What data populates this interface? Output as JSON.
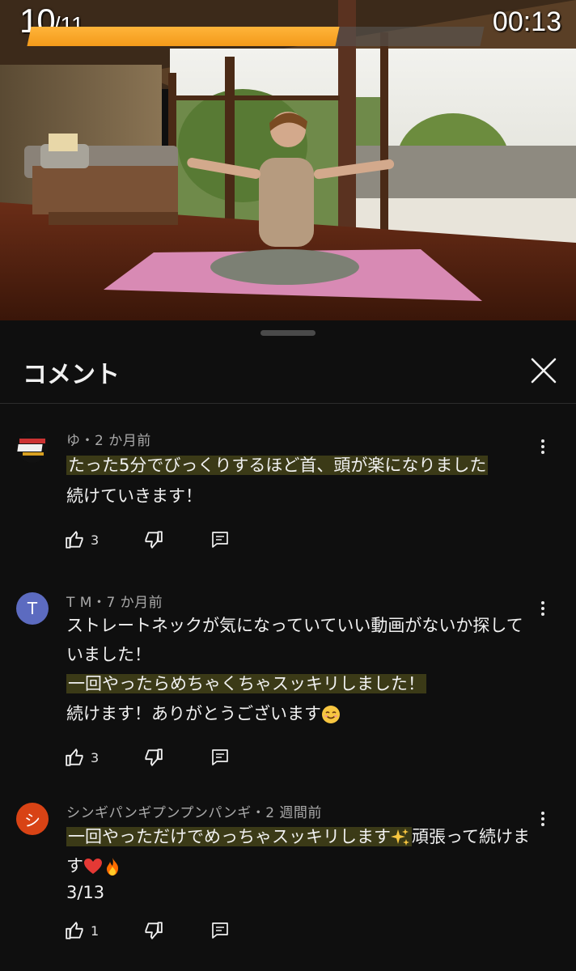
{
  "player": {
    "counter_current": "10",
    "counter_total": "/11",
    "timer": "00:13",
    "progress": 0.68
  },
  "sheet": {
    "title": "コメント"
  },
  "comments": [
    {
      "meta": "ゆ・2 か月前",
      "avatar_letter": "",
      "avatar_color": "#1c1c1c",
      "lines": [
        {
          "text": "たった5分でびっくりするほど首、頭が楽になりました",
          "highlight": true
        },
        {
          "text": "続けていきます！",
          "highlight": false
        }
      ],
      "likes": "3"
    },
    {
      "meta": "T M・7 か月前",
      "avatar_letter": "T",
      "avatar_color": "#5c6bc0",
      "lines": [
        {
          "text": "ストレートネックが気になっていていい動画がないか探して",
          "highlight": false
        },
        {
          "text": "いました！",
          "highlight": false
        },
        {
          "text": "一回やったらめちゃくちゃスッキリしました！",
          "highlight": true
        },
        {
          "text": "続けます！ありがとうございます",
          "highlight": false
        }
      ],
      "likes": "3"
    },
    {
      "meta": "シンギパンギプンプンパンギ・2 週間前",
      "avatar_letter": "シ",
      "avatar_color": "#d84315",
      "lines": [
        {
          "text": "一回やっただけでめっちゃスッキリします",
          "highlight": true,
          "tail": "頑張って続けま"
        },
        {
          "text": "す",
          "highlight": false
        },
        {
          "text": "3/13",
          "highlight": false
        }
      ],
      "likes": "1"
    }
  ],
  "icons": {
    "like": "thumbs-up-icon",
    "dislike": "thumbs-down-icon",
    "reply": "reply-icon",
    "menu": "more-vertical-icon",
    "close": "close-icon"
  }
}
